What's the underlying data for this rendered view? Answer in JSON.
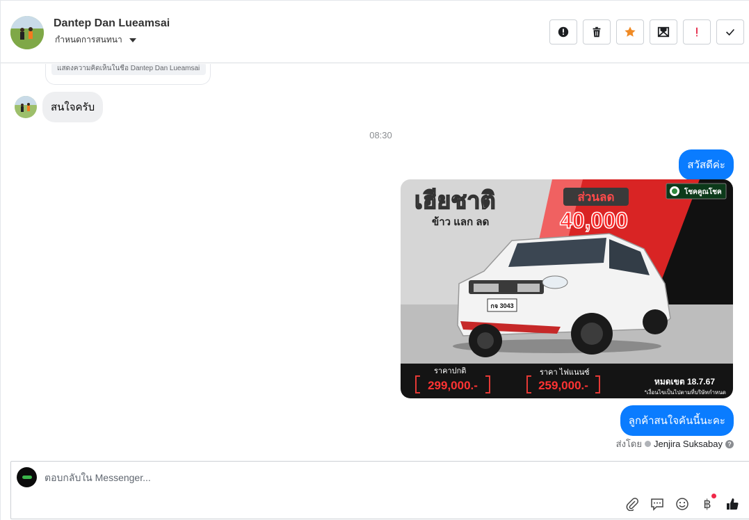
{
  "header": {
    "contact_name": "Dantep Dan Lueamsai",
    "assign_label": "กำหนดการสนทนา",
    "actions": [
      {
        "name": "spam",
        "icon": "alert-circle-icon"
      },
      {
        "name": "delete",
        "icon": "trash-icon"
      },
      {
        "name": "star",
        "icon": "star-icon"
      },
      {
        "name": "mark-unread",
        "icon": "envelope-icon"
      },
      {
        "name": "follow-up",
        "icon": "exclamation-icon"
      },
      {
        "name": "done",
        "icon": "check-icon"
      }
    ]
  },
  "conversation": {
    "previous_card_text": "แสดงความคิดเห็นในชื่อ Dantep Dan Lueamsai",
    "incoming_message": "สนใจครับ",
    "timestamp": "08:30",
    "outgoing_message_1": "สวัสดีค่ะ",
    "outgoing_message_2": "ลูกค้าสนใจคันนี้นะคะ",
    "sent_by_label": "ส่งโดย",
    "sent_by_agent": "Jenjira Suksabay"
  },
  "ad": {
    "headline": "เฮียชาติ",
    "subheadline": "ข้าว แลก ลด",
    "discount_label": "ส่วนลด",
    "discount_amount": "40,000",
    "brand": "โชคคูณโชค",
    "plate": "กจ 3043",
    "normal_price_label": "ราคาปกติ",
    "normal_price": "299,000.-",
    "finance_price_label": "ราคา ไฟแนนซ์",
    "finance_price": "259,000.-",
    "expiry": "หมดเขต 18.7.67",
    "terms": "*เงื่อนไขเป็นไปตามที่บริษัทกำหนด"
  },
  "composer": {
    "placeholder": "ตอบกลับใน Messenger..."
  },
  "colors": {
    "outgoing_bubble": "#0a7cff",
    "incoming_bubble": "#eeeff1",
    "star": "#f08a24",
    "follow_up": "#e41e3f",
    "like": "#1c1e21"
  }
}
